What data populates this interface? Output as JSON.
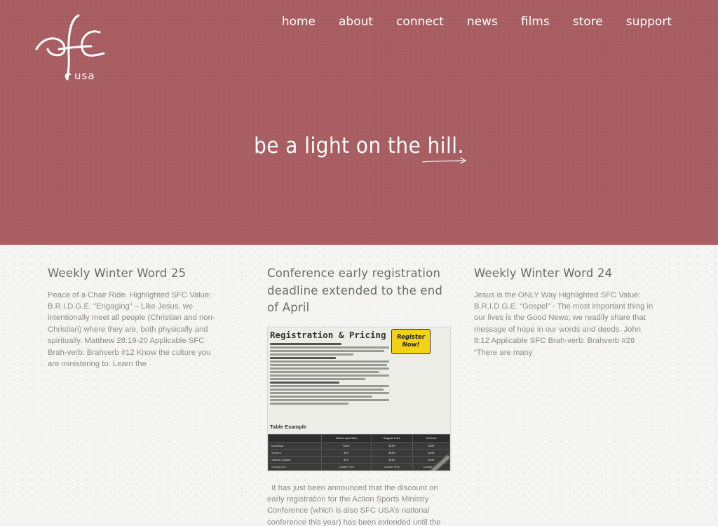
{
  "brand": {
    "logo_icon": "sfc-script-logo-icon",
    "logo_sub": "usa"
  },
  "nav": {
    "items": [
      "home",
      "about",
      "connect",
      "news",
      "films",
      "store",
      "support"
    ]
  },
  "hero": {
    "tagline": "be a light on the hill."
  },
  "posts": [
    {
      "title": "Weekly Winter Word 25",
      "excerpt": "Peace of a Chair Ride. Highlighted SFC Value:  B.R.I.D.G.E. “Engaging” – Like Jesus, we intentionally meet all people (Christian and non-Christian) where they are, both physically and spiritually. Matthew 28:19-20 Applicable SFC Brah-verb:  Brahverb #12 Know the culture you are ministering to. Learn the"
    },
    {
      "title": "Conference early registration deadline extended to the end of April",
      "flyer": {
        "heading": "Registration & Pricing",
        "badge": "Register Now!",
        "table_title": "Table Example",
        "table_headers": [
          "",
          "Before April 15th",
          "Regular Price",
          "At Event"
        ],
        "table_rows": [
          [
            "Individual",
            "$169",
            "$199",
            "$250"
          ],
          [
            "Seniors",
            "$79",
            "$199",
            "$199"
          ],
          [
            "Official Chapter",
            "$79",
            "$159",
            "$199"
          ],
          [
            "Groups of 6",
            "Leader Free",
            "Leader Free",
            "Leader Free"
          ]
        ]
      },
      "excerpt": "  It has just been announced that the discount on early registration for the Action Sports Ministry Conference (which is also SFC USA’s national conference this year) has been extended until the"
    },
    {
      "title": "Weekly Winter Word 24",
      "excerpt": "Jesus is the ONLY Way Highlighted SFC Value:  B.R.I.D.G.E. “Gospel” - The most important thing in our lives is the Good News; we readily share that message of hope in our words and deeds. John 8:12 Applicable SFC Brah-verb:   Brahverb #26 “There are many"
    }
  ],
  "colors": {
    "hero_bg": "#a85e62",
    "content_bg": "#f4f4f3",
    "title_text": "#6d6b6a",
    "body_text": "#8e8c8b"
  }
}
